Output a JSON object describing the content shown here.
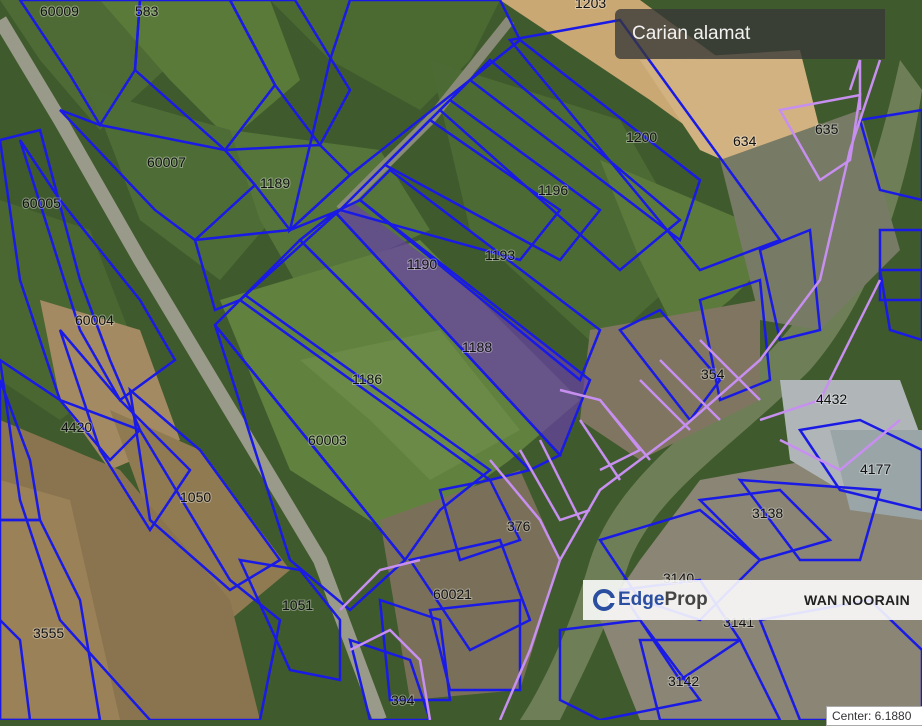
{
  "search": {
    "placeholder": "Carian alamat"
  },
  "watermark": {
    "brand": "EdgeProp",
    "brand_edge": "Edge",
    "brand_prop": "Prop",
    "agent_name": "WAN NOORAIN"
  },
  "center_readout": "Center: 6.1880",
  "lots": [
    "60009",
    "583",
    "1203",
    "1200",
    "634",
    "635",
    "60007",
    "1189",
    "1196",
    "60005",
    "1190",
    "1193",
    "60004",
    "1188",
    "354",
    "1186",
    "4432",
    "4420",
    "60003",
    "4177",
    "1050",
    "3138",
    "376",
    "3140",
    "60021",
    "1051",
    "3141",
    "3555",
    "3142",
    "394"
  ],
  "colors": {
    "lot_outline": "#1a1ae6",
    "lot_outline_alt": "#c78ff0",
    "selected_lot_fill": "#6a3db0"
  }
}
